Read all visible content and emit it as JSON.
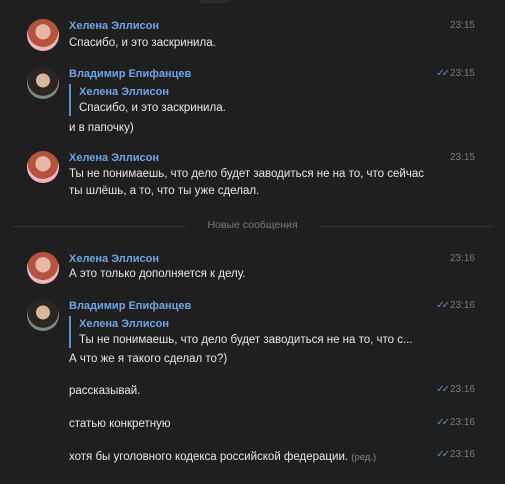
{
  "divider": {
    "label": "Новые сообщения"
  },
  "messages": [
    {
      "author": "Хелена Эллисон",
      "time": "23:15",
      "text": "Спасибо, и это заскринила."
    },
    {
      "author": "Владимир Епифанцев",
      "time": "23:15",
      "quote_author": "Хелена Эллисон",
      "quote_text": "Спасибо, и это заскринила.",
      "text": "и в папочку)"
    },
    {
      "author": "Хелена Эллисон",
      "time": "23:15",
      "text_line1": "Ты не понимаешь, что дело будет заводиться не на то, что сейчас",
      "text_line2": "ты шлёшь, а то, что ты уже сделал."
    },
    {
      "author": "Хелена Эллисон",
      "time": "23:16",
      "text": "А это только дополняется к делу."
    },
    {
      "author": "Владимир Епифанцев",
      "time": "23:16",
      "quote_author": "Хелена Эллисон",
      "quote_text": "Ты не понимаешь, что дело будет заводиться не на то, что с...",
      "text": "А что же я такого сделал то?)"
    },
    {
      "time": "23:16",
      "text": "рассказывай."
    },
    {
      "time": "23:16",
      "text": "статью конкретную"
    },
    {
      "time": "23:16",
      "text": "хотя бы уголовного кодекса российской федерации.",
      "edited": "(ред.)"
    }
  ],
  "icons": {
    "read_check": "double-check-icon"
  }
}
